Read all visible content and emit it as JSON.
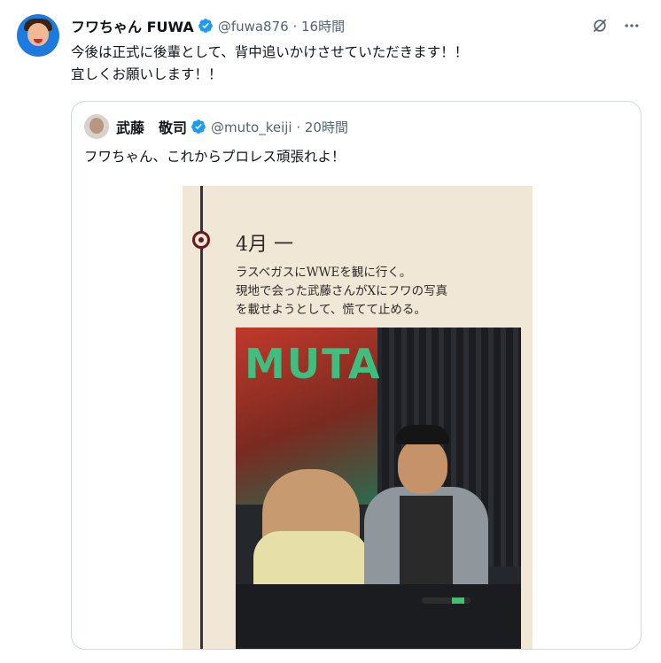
{
  "tweet": {
    "display_name": "フワちゃん FUWA",
    "handle_time": "@fuwa876 · 16時間",
    "text": "今後は正式に後輩として、背中追いかけさせていただきます！！\n宜しくお願いします！！"
  },
  "quoted": {
    "display_name": "武藤　敬司",
    "handle_time": "@muto_keiji · 20時間",
    "text": "フワちゃん、これからプロレス頑張れよ！",
    "image": {
      "month": "4月 一",
      "caption": "ラスベガスにWWEを観に行く。\n現地で会った武藤さんがXにフワの写真\nを載せようとして、慌てて止める。",
      "banner_text": "MUTA"
    }
  },
  "icons": {
    "verified": "verified-badge-icon",
    "grok": "grok-icon",
    "more": "more-options-icon"
  },
  "colors": {
    "verified": "#1d9bf0",
    "secondary_text": "#536471",
    "border": "#cfd9de"
  }
}
